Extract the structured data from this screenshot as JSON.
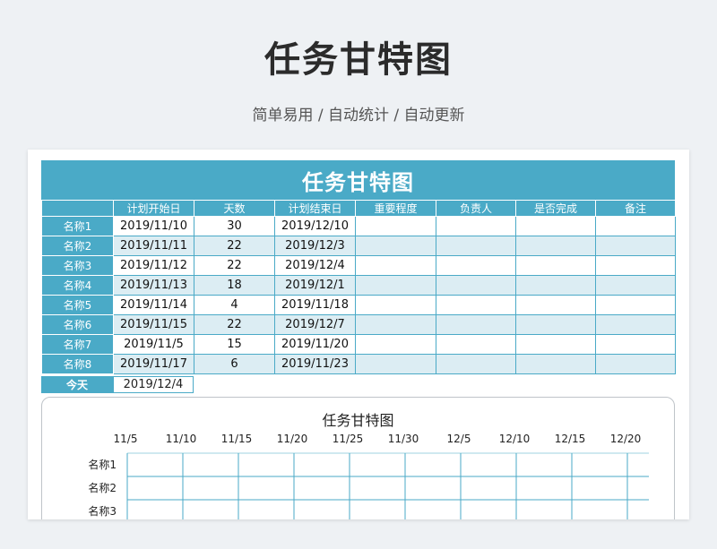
{
  "header": {
    "title": "任务甘特图",
    "subtitle": "简单易用 / 自动统计 / 自动更新"
  },
  "sheet": {
    "banner_title": "任务甘特图",
    "columns": [
      "",
      "计划开始日",
      "天数",
      "计划结束日",
      "重要程度",
      "负责人",
      "是否完成",
      "备注"
    ],
    "rows": [
      {
        "name": "名称1",
        "start": "2019/11/10",
        "days": "30",
        "end": "2019/12/10"
      },
      {
        "name": "名称2",
        "start": "2019/11/11",
        "days": "22",
        "end": "2019/12/3"
      },
      {
        "name": "名称3",
        "start": "2019/11/12",
        "days": "22",
        "end": "2019/12/4"
      },
      {
        "name": "名称4",
        "start": "2019/11/13",
        "days": "18",
        "end": "2019/12/1"
      },
      {
        "name": "名称5",
        "start": "2019/11/14",
        "days": "4",
        "end": "2019/11/18"
      },
      {
        "name": "名称6",
        "start": "2019/11/15",
        "days": "22",
        "end": "2019/12/7"
      },
      {
        "name": "名称7",
        "start": "2019/11/5",
        "days": "15",
        "end": "2019/11/20"
      },
      {
        "name": "名称8",
        "start": "2019/11/17",
        "days": "6",
        "end": "2019/11/23"
      }
    ],
    "today_label": "今天",
    "today_value": "2019/12/4"
  },
  "chart_data": {
    "type": "bar",
    "title": "任务甘特图",
    "x_tick_labels": [
      "11/5",
      "11/10",
      "11/15",
      "11/20",
      "11/25",
      "11/30",
      "12/5",
      "12/10",
      "12/15",
      "12/20"
    ],
    "categories": [
      "名称1",
      "名称2",
      "名称3"
    ],
    "grid": true
  },
  "colors": {
    "accent": "#4aaac7",
    "stripe": "#dcedf3"
  }
}
